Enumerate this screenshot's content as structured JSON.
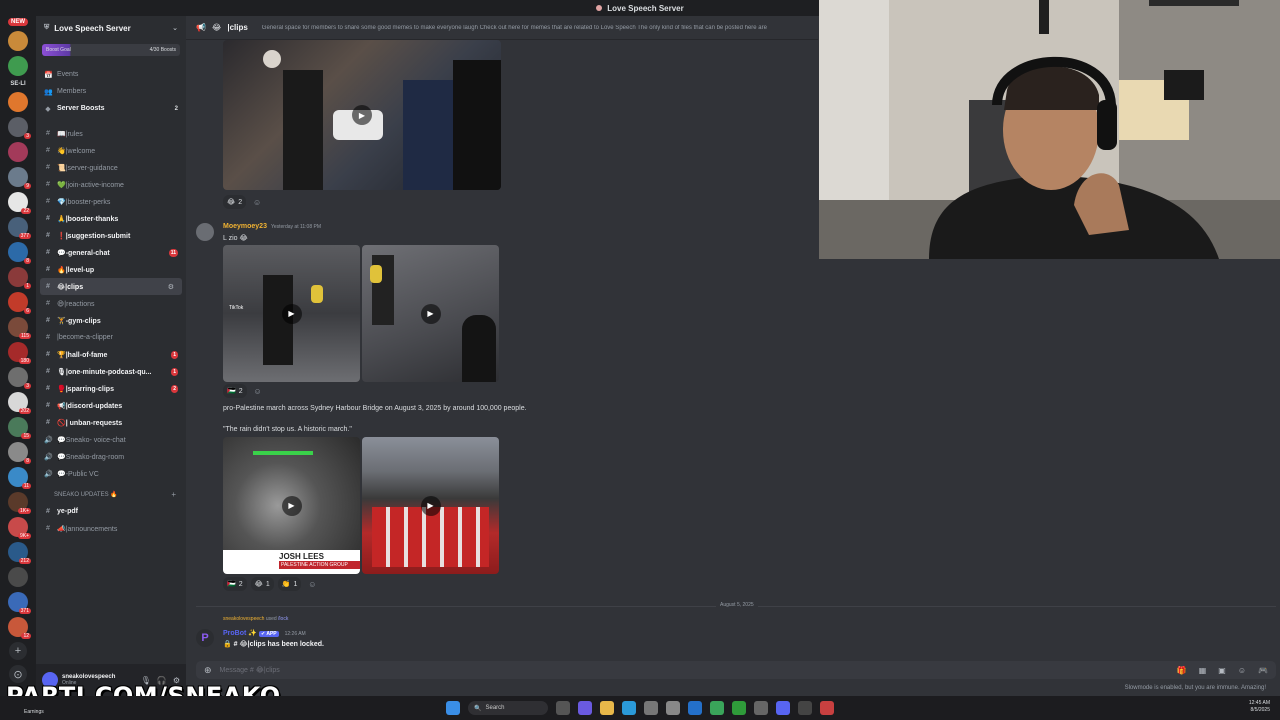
{
  "window": {
    "title": "Love Speech Server"
  },
  "rail": {
    "new_label": "NEW",
    "text_item": "SE-LI",
    "servers": [
      {
        "color": "#c98a3a",
        "badge": ""
      },
      {
        "color": "#3f9b4f",
        "badge": ""
      },
      {
        "color": "#e0772d",
        "badge": ""
      },
      {
        "color": "#5b5e66",
        "badge": "3"
      },
      {
        "color": "#a33a5a",
        "badge": ""
      },
      {
        "color": "#6b7b8c",
        "badge": "9"
      },
      {
        "color": "#e6e6e6",
        "badge": "22"
      },
      {
        "color": "#48607a",
        "badge": "377"
      },
      {
        "color": "#2c6aa8",
        "badge": "8"
      },
      {
        "color": "#8a3a3a",
        "badge": "1"
      },
      {
        "color": "#c23b2a",
        "badge": "6"
      },
      {
        "color": "#7a4a3a",
        "badge": "115"
      },
      {
        "color": "#a52a2a",
        "badge": "180"
      },
      {
        "color": "#6e6e6e",
        "badge": "3"
      },
      {
        "color": "#d8d8d8",
        "badge": "202"
      },
      {
        "color": "#4a7a5a",
        "badge": "15"
      },
      {
        "color": "#8a8a8a",
        "badge": "8"
      },
      {
        "color": "#3a8ac8",
        "badge": "11"
      },
      {
        "color": "#5a3a2a",
        "badge": "1K+"
      },
      {
        "color": "#c84a4a",
        "badge": "9K+"
      },
      {
        "color": "#2a5a8a",
        "badge": "212"
      },
      {
        "color": "#4a4a4a",
        "badge": ""
      },
      {
        "color": "#3a6ab8",
        "badge": "371"
      },
      {
        "color": "#c8583a",
        "badge": "12"
      }
    ]
  },
  "sidebar": {
    "server_name": "Love Speech Server",
    "boost_goal": "Boost Goal",
    "boost_count": "4/30 Boosts",
    "top_items": [
      {
        "label": "Events",
        "icon": "📅",
        "icon_name": "calendar-icon"
      },
      {
        "label": "Members",
        "icon": "👥",
        "icon_name": "members-icon"
      },
      {
        "label": "Server Boosts",
        "icon": "◆",
        "icon_name": "boost-icon",
        "count": "2"
      }
    ],
    "channels": [
      {
        "label": "📖|rules",
        "bright": false,
        "badge": ""
      },
      {
        "label": "👋|welcome",
        "bright": false,
        "badge": ""
      },
      {
        "label": "📜|server-guidance",
        "bright": false,
        "badge": ""
      },
      {
        "label": "💚|join-active-income",
        "bright": false,
        "badge": ""
      },
      {
        "label": "💎|booster-perks",
        "bright": false,
        "badge": ""
      },
      {
        "label": "🙏|booster-thanks",
        "bright": true,
        "badge": ""
      },
      {
        "label": "❗|suggestion-submit",
        "bright": true,
        "badge": ""
      },
      {
        "label": "💬-general-chat",
        "bright": true,
        "badge": "11"
      },
      {
        "label": "🔥|level-up",
        "bright": true,
        "badge": ""
      },
      {
        "label": "😂|clips",
        "bright": true,
        "badge": "",
        "active": true
      },
      {
        "label": "😄|reactions",
        "bright": false,
        "badge": ""
      },
      {
        "label": "🏋️-gym-clips",
        "bright": true,
        "badge": ""
      },
      {
        "label": "|become-a-clipper",
        "bright": false,
        "badge": ""
      },
      {
        "label": "🏆|hall-of-fame",
        "bright": true,
        "badge": "1"
      },
      {
        "label": "🎙|one-minute-podcast-qu...",
        "bright": true,
        "badge": "1"
      },
      {
        "label": "🥊|sparring-clips",
        "bright": true,
        "badge": "2"
      },
      {
        "label": "📢|discord-updates",
        "bright": true,
        "badge": ""
      },
      {
        "label": "🚫| unban-requests",
        "bright": true,
        "badge": ""
      },
      {
        "label": "💬Sneako- voice-chat",
        "bright": false,
        "badge": ""
      },
      {
        "label": "💬Sneako-drag-room",
        "bright": false,
        "badge": ""
      },
      {
        "label": "💬-Public VC",
        "bright": false,
        "badge": ""
      }
    ],
    "category": "SNEAKO UPDATES 🔥",
    "after_category": [
      {
        "label": "ye-pdf",
        "bright": true
      },
      {
        "label": "📣|announcements",
        "bright": false
      }
    ]
  },
  "user": {
    "name": "sneakolovespeech",
    "status": "Online"
  },
  "watermark": "PARTI.COM/SNEAKO",
  "chat": {
    "channel_name": "|clips",
    "topic": "General space for members to share some good memes to make everyone laugh Check out here for memes that are related to Love Speech The only kind of files that can be posted here are",
    "msg1": {
      "reactions": [
        {
          "emoji": "😂",
          "count": "2"
        }
      ]
    },
    "msg2": {
      "author": "Moeymoey23",
      "time": "Yesterday at 11:08 PM",
      "text": "L zio 😂",
      "reactions": [
        {
          "emoji": "🇵🇸",
          "count": "2"
        }
      ],
      "caption1": "pro-Palestine march across Sydney Harbour Bridge on August 3, 2025 by around 100,000 people.",
      "caption2": "\"The rain didn't stop us. A historic march.\"",
      "overlay_name": "JOSH LEES",
      "overlay_org": "PALESTINE ACTION GROUP",
      "tiktok": "TikTok",
      "reactions2": [
        {
          "emoji": "🇵🇸",
          "count": "2"
        },
        {
          "emoji": "😂",
          "count": "1"
        },
        {
          "emoji": "👏",
          "count": "1"
        }
      ]
    },
    "date_divider": "August 5, 2025",
    "system": {
      "reply_user": "sneakolovespeech",
      "reply_action": "used",
      "reply_cmd": "/lock",
      "bot_name": "ProBot ✨",
      "bot_tag": "✔ APP",
      "bot_time": "12:26 AM",
      "lock_text": "🔒 # 😂|clips has been locked."
    },
    "composer_placeholder": "Message # 😂|clips",
    "slowmode_text": "Slowmode is enabled, but you are immune. Amazing!"
  },
  "taskbar": {
    "search_label": "Search",
    "time": "12:45 AM",
    "date": "8/5/2025",
    "earnings": "Earnings"
  },
  "colors": {
    "accent": "#5865f2",
    "bg": "#313338",
    "sidebar": "#2b2d31"
  }
}
